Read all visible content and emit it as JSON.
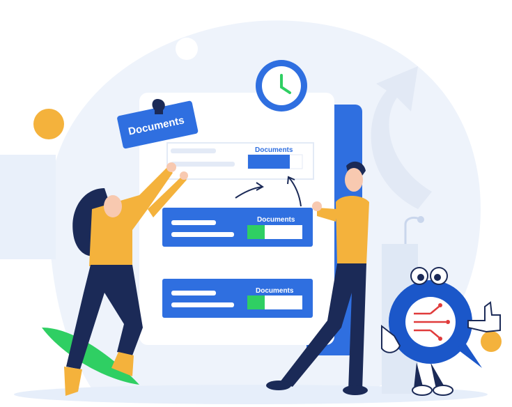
{
  "illustration": {
    "tag_label": "Documents",
    "card_top_label": "Documents",
    "card_mid_label": "Documents",
    "card_bottom_label": "Documents",
    "progress": {
      "top": 0.85,
      "middle": 0.32,
      "bottom": 0.32
    }
  },
  "colors": {
    "accent_blue": "#2f6fe0",
    "light_bg": "#eef3fb",
    "progress_green": "#2fcf63",
    "orange": "#f4b23c",
    "navy": "#1b2a57"
  },
  "icons": [
    "clock-icon",
    "arrow-icon",
    "thumbs-up-icon",
    "circuit-logo-icon",
    "pin-icon"
  ]
}
